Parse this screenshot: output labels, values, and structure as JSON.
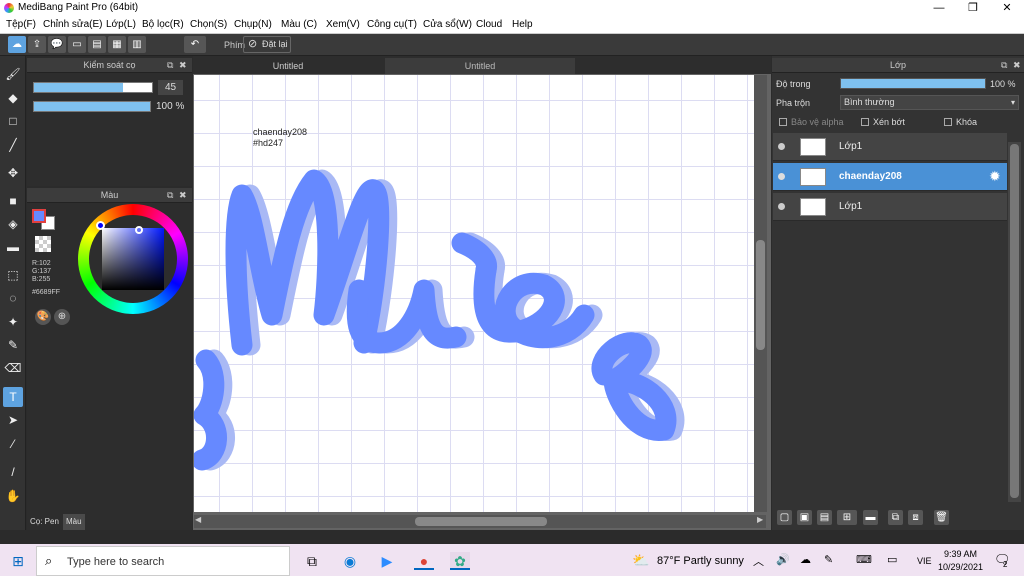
{
  "window": {
    "title": "MediBang Paint Pro (64bit)"
  },
  "menu": [
    "Tệp(F)",
    "Chỉnh sửa(E)",
    "Lớp(L)",
    "Bộ lọc(R)",
    "Chọn(S)",
    "Chụp(N)",
    "Màu (C)",
    "Xem(V)",
    "Công cụ(T)",
    "Cửa sổ(W)",
    "Cloud",
    "Help"
  ],
  "toolbar": {
    "phim_label": "Phím",
    "reset_label": "Đặt lại"
  },
  "brush_panel": {
    "title": "Kiểm soát cọ",
    "size_value": "45",
    "size_fill": 0.75,
    "opacity_value": "100 %",
    "opacity_fill": 1.0
  },
  "color_panel": {
    "title": "Màu",
    "r": "R:102",
    "g": "G:137",
    "b": "B:255",
    "hex": "#6689FF",
    "current_color": "#6689FF"
  },
  "left_tabs": {
    "brush_tab": "Cọ: Pen",
    "color_tab": "Màu"
  },
  "canvas": {
    "tabs": [
      "Untitled",
      "Untitled"
    ],
    "text_line1": "chaenday208",
    "text_line2": "#hd247",
    "stroke_color": "#6689FF",
    "shadow_color": "#a9b9f5"
  },
  "layer_panel": {
    "title": "Lớp",
    "opacity_label": "Độ trong",
    "opacity_value": "100 %",
    "opacity_fill": 1.0,
    "blend_label": "Pha trộn",
    "blend_value": "Bình thường",
    "alpha_label": "Bảo vệ alpha",
    "clip_label": "Xén bớt",
    "lock_label": "Khóa",
    "layers": [
      {
        "name": "Lớp1",
        "selected": false
      },
      {
        "name": "chaenday208",
        "selected": true
      },
      {
        "name": "Lớp1",
        "selected": false
      }
    ]
  },
  "taskbar": {
    "search_placeholder": "Type here to search",
    "weather": "87°F  Partly sunny",
    "lang": "VIE",
    "time": "9:39 AM",
    "date": "10/29/2021",
    "notif_count": "2"
  }
}
